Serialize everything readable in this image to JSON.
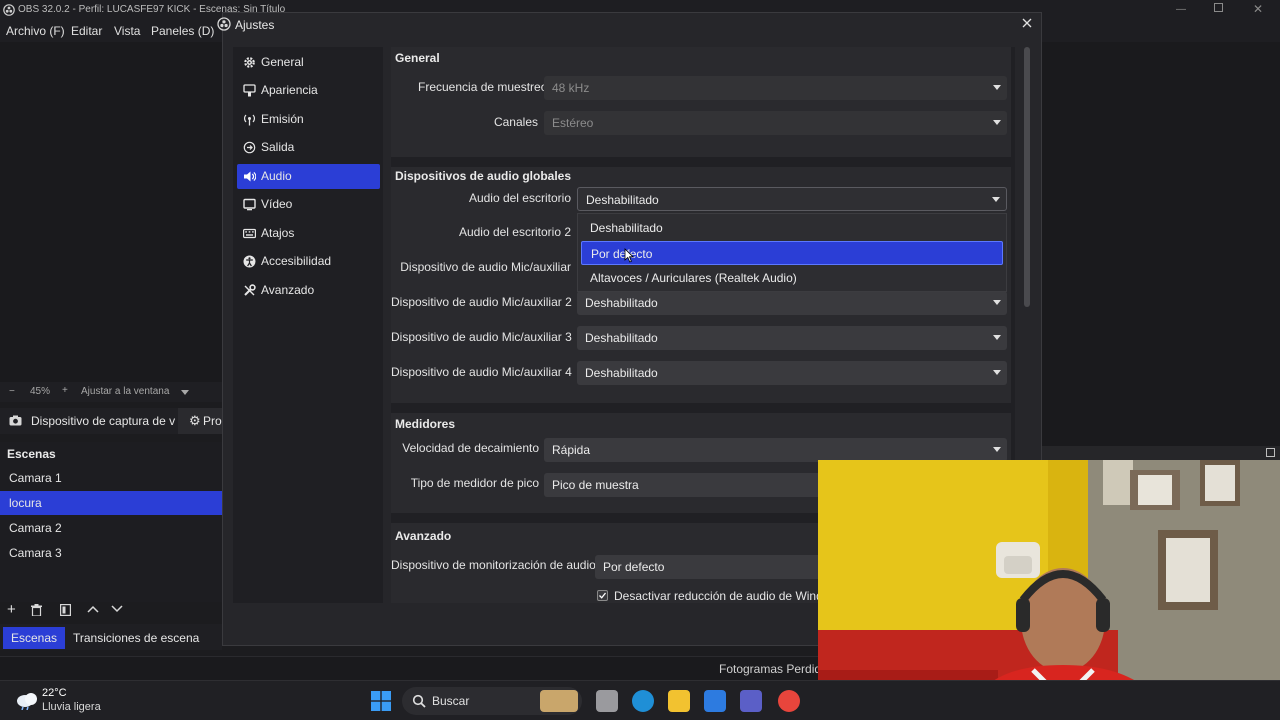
{
  "obs": {
    "title": "OBS 32.0.2 - Perfil: LUCASFE97 KICK - Escenas: Sin Título",
    "menu": [
      "Archivo (F)",
      "Editar",
      "Vista",
      "Paneles (D)"
    ],
    "zoom": {
      "minus": "−",
      "value": "45%",
      "plus": "+",
      "fit": "Ajustar a la ventana"
    },
    "source": {
      "name": "Dispositivo de captura de v",
      "props": "Prop"
    },
    "scenes_title": "Escenas",
    "scenes": [
      "Camara 1",
      "locura",
      "Camara 2",
      "Camara 3"
    ],
    "selected_scene": "locura",
    "dock_tabs": [
      "Escenas",
      "Transiciones de escena"
    ],
    "status_text": "Fotogramas Perdidos"
  },
  "dialog": {
    "title": "Ajustes",
    "nav": [
      {
        "label": "General",
        "icon": "gear-icon"
      },
      {
        "label": "Apariencia",
        "icon": "brush-icon"
      },
      {
        "label": "Emisión",
        "icon": "antenna-icon"
      },
      {
        "label": "Salida",
        "icon": "output-icon"
      },
      {
        "label": "Audio",
        "icon": "speaker-icon"
      },
      {
        "label": "Vídeo",
        "icon": "monitor-icon"
      },
      {
        "label": "Atajos",
        "icon": "keyboard-icon"
      },
      {
        "label": "Accesibilidad",
        "icon": "accessibility-icon"
      },
      {
        "label": "Avanzado",
        "icon": "wrench-icon"
      }
    ],
    "active_nav": "Audio",
    "general": {
      "title": "General",
      "sample_rate_label": "Frecuencia de muestreo",
      "sample_rate_value": "48 kHz",
      "channels_label": "Canales",
      "channels_value": "Estéreo"
    },
    "global_devices": {
      "title": "Dispositivos de audio globales",
      "desktop_label": "Audio del escritorio",
      "desktop_value": "Deshabilitado",
      "desktop2_label": "Audio del escritorio 2",
      "mic_label": "Dispositivo de audio Mic/auxiliar",
      "mic2_label": "Dispositivo de audio Mic/auxiliar 2",
      "mic2_value": "Deshabilitado",
      "mic3_label": "Dispositivo de audio Mic/auxiliar 3",
      "mic3_value": "Deshabilitado",
      "mic4_label": "Dispositivo de audio Mic/auxiliar 4",
      "mic4_value": "Deshabilitado"
    },
    "dropdown_options": [
      "Deshabilitado",
      "Por defecto",
      "Altavoces / Auriculares (Realtek Audio)"
    ],
    "dropdown_highlighted": "Por defecto",
    "meters": {
      "title": "Medidores",
      "decay_label": "Velocidad de decaimiento",
      "decay_value": "Rápida",
      "peak_label": "Tipo de medidor de pico",
      "peak_value": "Pico de muestra"
    },
    "advanced": {
      "title": "Avanzado",
      "monitor_label": "Dispositivo de monitorización de audio",
      "monitor_value": "Por defecto",
      "ducking_label": "Desactivar reducción de audio de Windo",
      "ducking_checked": true
    }
  },
  "taskbar": {
    "temp": "22°C",
    "weather": "Lluvia ligera",
    "search": "Buscar"
  },
  "colors": {
    "accent": "#2b3ed6",
    "window_bg": "#26262a",
    "panel_bg": "#2a2a2e"
  }
}
